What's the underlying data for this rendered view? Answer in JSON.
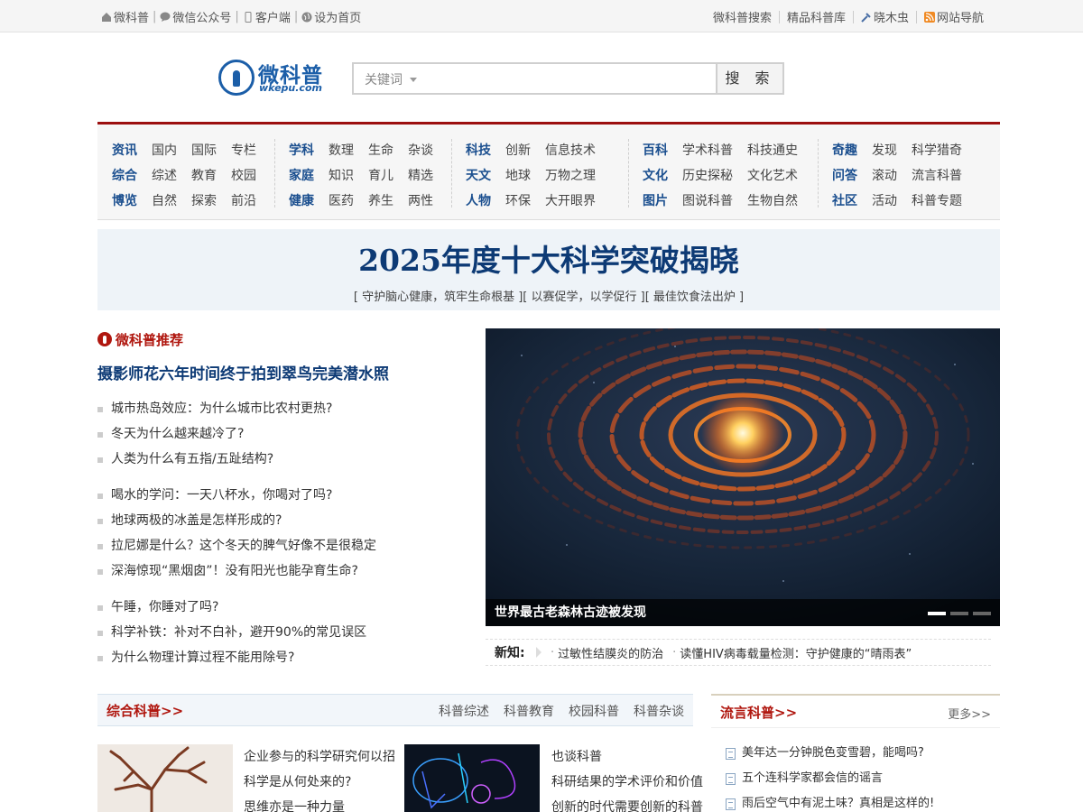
{
  "topbar": {
    "left": [
      "微科普",
      "微信公众号",
      "客户端",
      "设为首页"
    ],
    "right": [
      "微科普搜索",
      "精品科普库",
      "晓木虫",
      "网站导航"
    ]
  },
  "logo": {
    "cn": "微科普",
    "en": "wkepu.com"
  },
  "search": {
    "select": "关键词",
    "button": "搜 索"
  },
  "nav": [
    {
      "rows": [
        {
          "cat": "资讯",
          "items": [
            "国内",
            "国际",
            "专栏"
          ]
        },
        {
          "cat": "综合",
          "items": [
            "综述",
            "教育",
            "校园"
          ]
        },
        {
          "cat": "博览",
          "items": [
            "自然",
            "探索",
            "前沿"
          ]
        }
      ]
    },
    {
      "rows": [
        {
          "cat": "学科",
          "items": [
            "数理",
            "生命",
            "杂谈"
          ]
        },
        {
          "cat": "家庭",
          "items": [
            "知识",
            "育儿",
            "精选"
          ]
        },
        {
          "cat": "健康",
          "items": [
            "医药",
            "养生",
            "两性"
          ]
        }
      ]
    },
    {
      "rows": [
        {
          "cat": "科技",
          "items": [
            "创新",
            "信息技术"
          ]
        },
        {
          "cat": "天文",
          "items": [
            "地球",
            "万物之理"
          ]
        },
        {
          "cat": "人物",
          "items": [
            "环保",
            "大开眼界"
          ]
        }
      ]
    },
    {
      "rows": [
        {
          "cat": "百科",
          "items": [
            "学术科普",
            "科技通史"
          ]
        },
        {
          "cat": "文化",
          "items": [
            "历史探秘",
            "文化艺术"
          ]
        },
        {
          "cat": "图片",
          "items": [
            "图说科普",
            "生物自然"
          ]
        }
      ]
    },
    {
      "rows": [
        {
          "cat": "奇趣",
          "items": [
            "发现",
            "科学猎奇"
          ]
        },
        {
          "cat": "问答",
          "items": [
            "滚动",
            "流言科普"
          ]
        },
        {
          "cat": "社区",
          "items": [
            "活动",
            "科普专题"
          ]
        }
      ]
    }
  ],
  "banner": {
    "headline": "2025年度十大科学突破揭晓",
    "sub": "[ 守护脑心健康，筑牢生命根基 ][ 以赛促学，以学促行 ][ 最佳饮食法出炉 ]"
  },
  "recommend": {
    "title": "微科普推荐",
    "headline": "摄影师花六年时间终于拍到翠鸟完美潜水照",
    "groups": [
      [
        "城市热岛效应：为什么城市比农村更热?",
        "冬天为什么越来越冷了?",
        "人类为什么有五指/五趾结构?"
      ],
      [
        "喝水的学问：一天八杯水，你喝对了吗?",
        "地球两极的冰盖是怎样形成的?",
        "拉尼娜是什么？这个冬天的脾气好像不是很稳定",
        "深海惊现“黑烟囱”！没有阳光也能孕育生命?"
      ],
      [
        "午睡，你睡对了吗?",
        "科学补铁：补对不白补，避开90%的常见误区",
        "为什么物理计算过程不能用除号?"
      ]
    ]
  },
  "slideshow": {
    "caption": "世界最古老森林古迹被发现",
    "slides": 3,
    "active": 0
  },
  "ticker": {
    "label": "新知:",
    "items": [
      "过敏性结膜炎的防治",
      "读懂HIV病毒载量检测：守护健康的“晴雨表”"
    ]
  },
  "section": {
    "title": "综合科普>>",
    "tabs": [
      "科普综述",
      "科普教育",
      "校园科普",
      "科普杂谈"
    ],
    "list1": [
      "企业参与的科学研究何以招",
      "科学是从何处来的?",
      "思维亦是一种力量"
    ],
    "list2": [
      "也谈科普",
      "科研结果的学术评价和价值",
      "创新的时代需要创新的科普"
    ]
  },
  "side": {
    "title": "流言科普>>",
    "more": "更多>>",
    "items": [
      "美年达一分钟脱色变雪碧，能喝吗?",
      "五个连科学家都会信的谣言",
      "雨后空气中有泥土味？真相是这样的!"
    ]
  },
  "colors": {
    "brand_red": "#9c1010",
    "nav_blue": "#1b4f8f",
    "headline_blue": "#0d3a75"
  }
}
